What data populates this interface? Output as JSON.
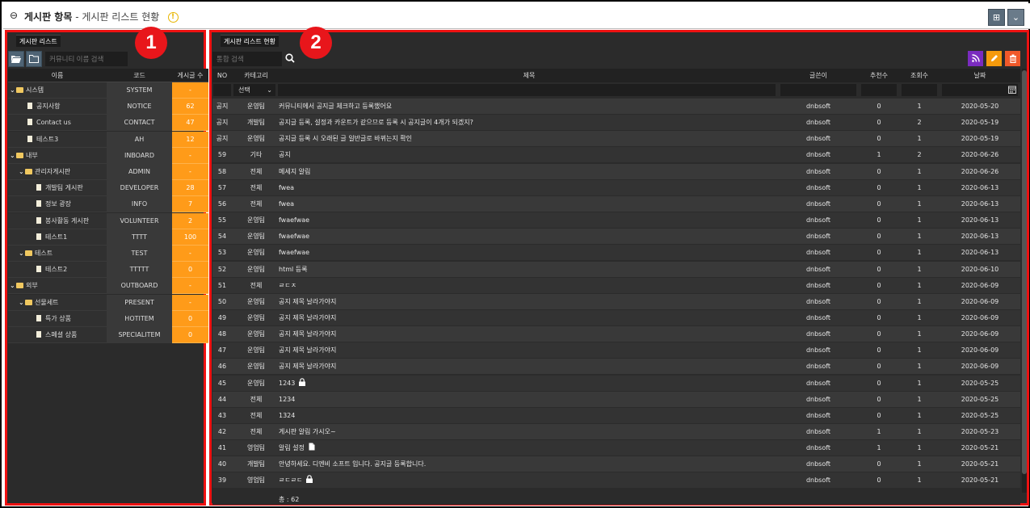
{
  "header": {
    "title": "게시판 항목",
    "separator": " - ",
    "subtitle": "게시판 리스트 현황",
    "warning_glyph": "!",
    "grid_glyph": "⊞",
    "dropdown_glyph": "⌄",
    "back_glyph": "⊖"
  },
  "annotations": {
    "badge1": "1",
    "badge2": "2"
  },
  "left": {
    "tab": "게시판 리스트",
    "search_placeholder": "커뮤니티 이름 검색",
    "columns": {
      "name": "이름",
      "code": "코드",
      "count": "게시글 수"
    },
    "rows": [
      {
        "name": "시스템",
        "code": "SYSTEM",
        "count": "-",
        "level": 0,
        "folder": true
      },
      {
        "name": "공지사항",
        "code": "NOTICE",
        "count": "62",
        "level": 1,
        "folder": false
      },
      {
        "name": "Contact us",
        "code": "CONTACT",
        "count": "47",
        "level": 1,
        "folder": false
      },
      {
        "name": "테스트3",
        "code": "AH",
        "count": "12",
        "level": 1,
        "folder": false
      },
      {
        "name": "내부",
        "code": "INBOARD",
        "count": "-",
        "level": 0,
        "folder": true
      },
      {
        "name": "관리자게시판",
        "code": "ADMIN",
        "count": "-",
        "level": 1,
        "folder": true
      },
      {
        "name": "개발팀 게시판",
        "code": "DEVELOPER",
        "count": "28",
        "level": 2,
        "folder": false
      },
      {
        "name": "정보 광장",
        "code": "INFO",
        "count": "7",
        "level": 2,
        "folder": false
      },
      {
        "name": "봉사활동 게시판",
        "code": "VOLUNTEER",
        "count": "2",
        "level": 2,
        "folder": false
      },
      {
        "name": "테스트1",
        "code": "TTTT",
        "count": "100",
        "level": 2,
        "folder": false
      },
      {
        "name": "테스트",
        "code": "TEST",
        "count": "-",
        "level": 1,
        "folder": true
      },
      {
        "name": "테스트2",
        "code": "TTTTT",
        "count": "0",
        "level": 2,
        "folder": false
      },
      {
        "name": "외부",
        "code": "OUTBOARD",
        "count": "-",
        "level": 0,
        "folder": true
      },
      {
        "name": "선물세트",
        "code": "PRESENT",
        "count": "-",
        "level": 1,
        "folder": true
      },
      {
        "name": "특가 상품",
        "code": "HOTITEM",
        "count": "0",
        "level": 2,
        "folder": false
      },
      {
        "name": "스페셜 상품",
        "code": "SPECIALITEM",
        "count": "0",
        "level": 2,
        "folder": false
      }
    ]
  },
  "right": {
    "tab": "게시판 리스트 현황",
    "search_placeholder": "통합 검색",
    "columns": {
      "no": "NO",
      "category": "카테고리",
      "title": "제목",
      "author": "글쓴이",
      "recommend": "추천수",
      "views": "조회수",
      "date": "날짜"
    },
    "category_select": "선택",
    "rows": [
      {
        "no": "공지",
        "cat": "운영팀",
        "title": "커뮤니티에서 공지글 체크하고 등록했어요",
        "author": "dnbsoft",
        "rec": "0",
        "views": "1",
        "date": "2020-05-20"
      },
      {
        "no": "공지",
        "cat": "개발팀",
        "title": "공지글 등록, 설정과 카운트가 같으므로 등록 시 공지글이 4개가 되겠지?",
        "author": "dnbsoft",
        "rec": "0",
        "views": "2",
        "date": "2020-05-19"
      },
      {
        "no": "공지",
        "cat": "운영팀",
        "title": "공지글 등록 시 오래된 글 일반글로 바뀌는지 확인",
        "author": "dnbsoft",
        "rec": "0",
        "views": "1",
        "date": "2020-05-19"
      },
      {
        "no": "59",
        "cat": "기타",
        "title": "공지",
        "author": "dnbsoft",
        "rec": "1",
        "views": "2",
        "date": "2020-06-26"
      },
      {
        "no": "58",
        "cat": "전체",
        "title": "메세지 알림",
        "author": "dnbsoft",
        "rec": "0",
        "views": "1",
        "date": "2020-06-26"
      },
      {
        "no": "57",
        "cat": "전체",
        "title": "fwea",
        "author": "dnbsoft",
        "rec": "0",
        "views": "1",
        "date": "2020-06-13"
      },
      {
        "no": "56",
        "cat": "전체",
        "title": "fwea",
        "author": "dnbsoft",
        "rec": "0",
        "views": "1",
        "date": "2020-06-13"
      },
      {
        "no": "55",
        "cat": "운영팀",
        "title": "fwaefwae",
        "author": "dnbsoft",
        "rec": "0",
        "views": "1",
        "date": "2020-06-13"
      },
      {
        "no": "54",
        "cat": "운영팀",
        "title": "fwaefwae",
        "author": "dnbsoft",
        "rec": "0",
        "views": "1",
        "date": "2020-06-13"
      },
      {
        "no": "53",
        "cat": "운영팀",
        "title": "fwaefwae",
        "author": "dnbsoft",
        "rec": "0",
        "views": "1",
        "date": "2020-06-13"
      },
      {
        "no": "52",
        "cat": "운영팀",
        "title": "html 등록",
        "author": "dnbsoft",
        "rec": "0",
        "views": "1",
        "date": "2020-06-10"
      },
      {
        "no": "51",
        "cat": "전체",
        "title": "ㄹㄷㅈ",
        "author": "dnbsoft",
        "rec": "0",
        "views": "1",
        "date": "2020-06-09"
      },
      {
        "no": "50",
        "cat": "운영팀",
        "title": "공지 제목 날라가야지",
        "author": "dnbsoft",
        "rec": "0",
        "views": "1",
        "date": "2020-06-09"
      },
      {
        "no": "49",
        "cat": "운영팀",
        "title": "공지 제목 날라가야지",
        "author": "dnbsoft",
        "rec": "0",
        "views": "1",
        "date": "2020-06-09"
      },
      {
        "no": "48",
        "cat": "운영팀",
        "title": "공지 제목 날라가야지",
        "author": "dnbsoft",
        "rec": "0",
        "views": "1",
        "date": "2020-06-09"
      },
      {
        "no": "47",
        "cat": "운영팀",
        "title": "공지 제목 날라가야지",
        "author": "dnbsoft",
        "rec": "0",
        "views": "1",
        "date": "2020-06-09"
      },
      {
        "no": "46",
        "cat": "운영팀",
        "title": "공지 제목 날라가야지",
        "author": "dnbsoft",
        "rec": "0",
        "views": "1",
        "date": "2020-06-09"
      },
      {
        "no": "45",
        "cat": "운영팀",
        "title": "1243",
        "author": "dnbsoft",
        "rec": "0",
        "views": "1",
        "date": "2020-05-25",
        "icon": "lock-icon"
      },
      {
        "no": "44",
        "cat": "전체",
        "title": "1234",
        "author": "dnbsoft",
        "rec": "0",
        "views": "1",
        "date": "2020-05-25"
      },
      {
        "no": "43",
        "cat": "전체",
        "title": "1324",
        "author": "dnbsoft",
        "rec": "0",
        "views": "1",
        "date": "2020-05-25"
      },
      {
        "no": "42",
        "cat": "전체",
        "title": "게시판 알림 가시오~",
        "author": "dnbsoft",
        "rec": "1",
        "views": "1",
        "date": "2020-05-23"
      },
      {
        "no": "41",
        "cat": "영업팀",
        "title": "알림 설정",
        "author": "dnbsoft",
        "rec": "1",
        "views": "1",
        "date": "2020-05-21",
        "icon": "file-icon"
      },
      {
        "no": "40",
        "cat": "개발팀",
        "title": "안녕하세요. 디엔비 소프트 입니다. 공지글 등록합니다.",
        "author": "dnbsoft",
        "rec": "0",
        "views": "1",
        "date": "2020-05-21"
      },
      {
        "no": "39",
        "cat": "영업팀",
        "title": "ㄹㄷㄹㄷ",
        "author": "dnbsoft",
        "rec": "0",
        "views": "1",
        "date": "2020-05-21",
        "icon": "lock-icon"
      }
    ],
    "total": "총 : 62"
  },
  "colors": {
    "accent_orange": "#ff9b19",
    "border_red": "#e11",
    "rss_purple": "#7a2bbf",
    "edit_orange": "#f59a0c",
    "delete_red": "#f0592a"
  }
}
